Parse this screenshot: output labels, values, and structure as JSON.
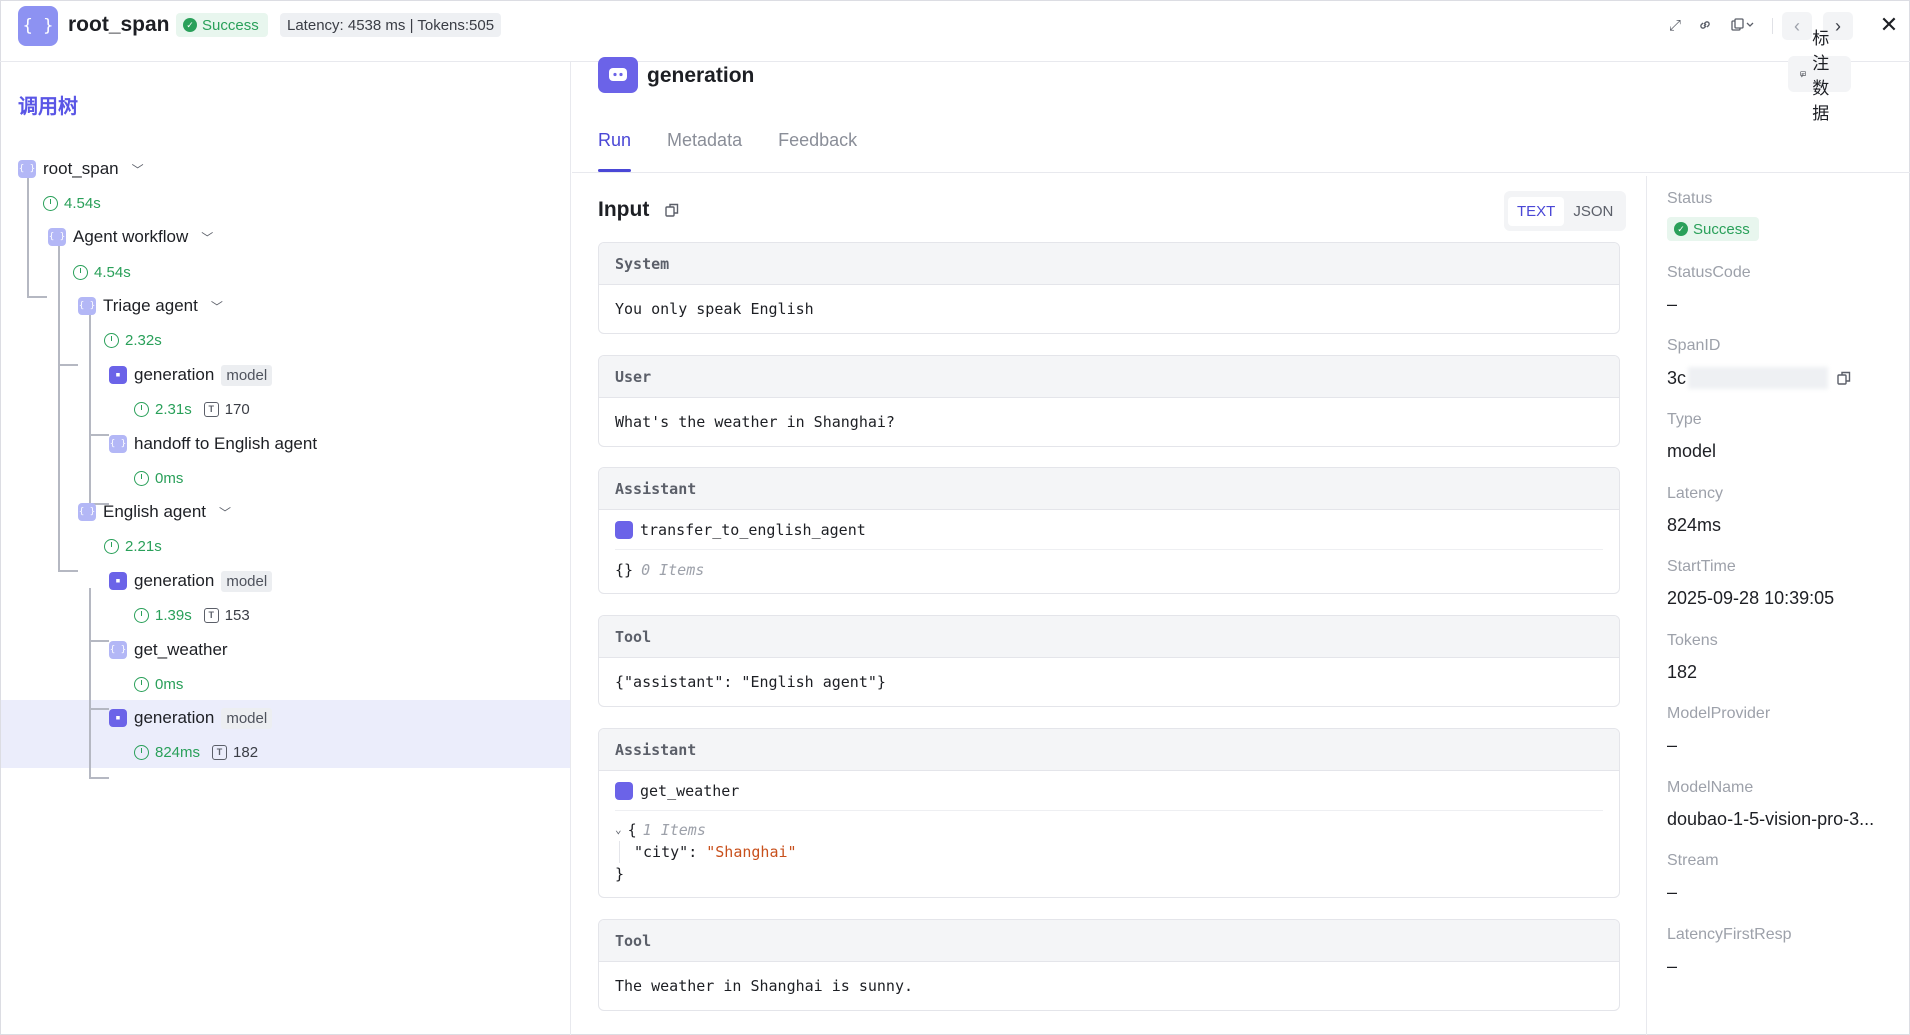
{
  "header": {
    "title": "root_span",
    "status": "Success",
    "stats": "Latency: 4538 ms | Tokens:505"
  },
  "tree": {
    "title": "调用树",
    "nodes": [
      {
        "label": "root_span",
        "time": "4.54s"
      },
      {
        "label": "Agent workflow",
        "time": "4.54s"
      },
      {
        "label": "Triage agent",
        "time": "2.32s"
      },
      {
        "label": "generation",
        "tag": "model",
        "time": "2.31s",
        "tokens": "170"
      },
      {
        "label": "handoff to English agent",
        "time": "0ms"
      },
      {
        "label": "English agent",
        "time": "2.21s"
      },
      {
        "label": "generation",
        "tag": "model",
        "time": "1.39s",
        "tokens": "153"
      },
      {
        "label": "get_weather",
        "time": "0ms"
      },
      {
        "label": "generation",
        "tag": "model",
        "time": "824ms",
        "tokens": "182"
      }
    ]
  },
  "detail": {
    "title": "generation",
    "annotate": "标注数据",
    "tabs": [
      "Run",
      "Metadata",
      "Feedback"
    ],
    "input_label": "Input",
    "formats": [
      "TEXT",
      "JSON"
    ],
    "messages": {
      "system": {
        "role": "System",
        "text": "You only speak English"
      },
      "user": {
        "role": "User",
        "text": "What's the weather in Shanghai?"
      },
      "assistant1": {
        "role": "Assistant",
        "tool": "transfer_to_english_agent",
        "args": "{}",
        "args_note": "0 Items"
      },
      "tool1": {
        "role": "Tool",
        "text": "{\"assistant\": \"English agent\"}"
      },
      "assistant2": {
        "role": "Assistant",
        "tool": "get_weather",
        "brace_open": "{",
        "items_note": "1 Items",
        "key": "\"city\"",
        "colon": ":",
        "value": "\"Shanghai\"",
        "brace_close": "}"
      },
      "tool2": {
        "role": "Tool",
        "text": "The weather in Shanghai is sunny."
      }
    }
  },
  "props": {
    "status_k": "Status",
    "status_v": "Success",
    "statuscode_k": "StatusCode",
    "statuscode_v": "–",
    "spanid_k": "SpanID",
    "spanid_v": "3c",
    "type_k": "Type",
    "type_v": "model",
    "latency_k": "Latency",
    "latency_v": "824ms",
    "starttime_k": "StartTime",
    "starttime_v": "2025-09-28 10:39:05",
    "tokens_k": "Tokens",
    "tokens_v": "182",
    "provider_k": "ModelProvider",
    "provider_v": "–",
    "modelname_k": "ModelName",
    "modelname_v": "doubao-1-5-vision-pro-3...",
    "stream_k": "Stream",
    "stream_v": "–",
    "latencyfirst_k": "LatencyFirstResp",
    "latencyfirst_v": "–"
  },
  "colors": {
    "accent": "#4a47d6",
    "success": "#2aa05a",
    "node_span": "#b3b7f6",
    "node_gen": "#6b63e8"
  }
}
